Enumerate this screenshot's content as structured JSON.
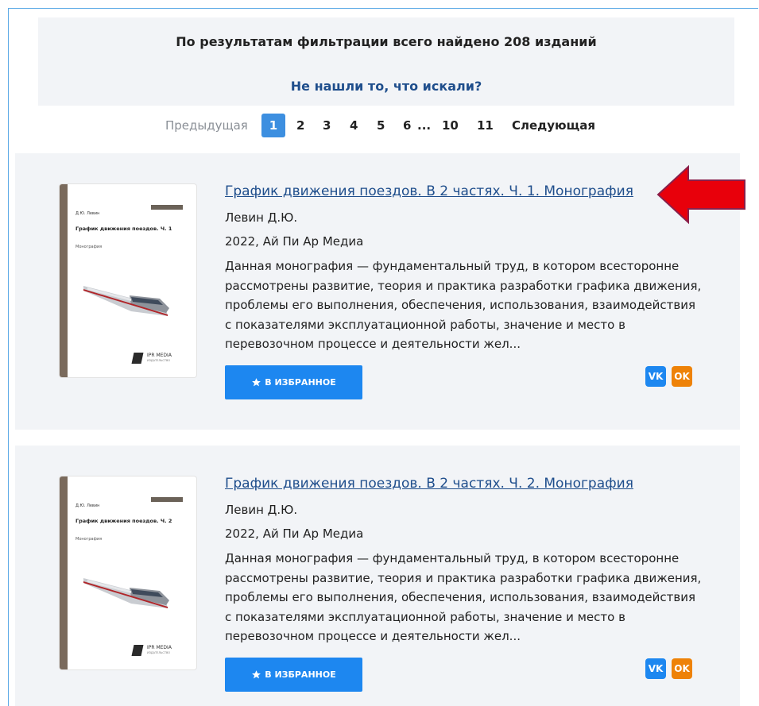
{
  "results": {
    "count_text": "По результатам фильтрации всего найдено 208 изданий",
    "not_found_link": "Не нашли то, что искали?"
  },
  "pagination": {
    "prev_label": "Предыдущая",
    "pages": [
      "1",
      "2",
      "3",
      "4",
      "5",
      "6"
    ],
    "ellipsis": "...",
    "tail_pages": [
      "10",
      "11"
    ],
    "next_label": "Следующая",
    "current": "1"
  },
  "books": [
    {
      "title": "График движения поездов. В 2 частях. Ч. 1. Монография",
      "author": "Левин Д.Ю.",
      "year_publisher": "2022, Ай Пи Ар Медиа",
      "description": "Данная монография — фундаментальный труд, в котором всесторонне рассмотрены развитие, теория и практика разработки графика движения, проблемы его выполнения, обеспечения, использования, взаимодействия с показателями эксплуатационной работы, значение и место в перевозочном процессе и деятельности жел...",
      "fav_label": "В ИЗБРАННОЕ",
      "cover_author": "Д.Ю. Левин",
      "cover_title": "График движения поездов. Ч. 1",
      "cover_genre": "Монография"
    },
    {
      "title": "График движения поездов. В 2 частях. Ч. 2. Монография",
      "author": "Левин Д.Ю.",
      "year_publisher": "2022, Ай Пи Ар Медиа",
      "description": "Данная монография — фундаментальный труд, в котором всесторонне рассмотрены развитие, теория и практика разработки графика движения, проблемы его выполнения, обеспечения, использования, взаимодействия с показателями эксплуатационной работы, значение и место в перевозочном процессе и деятельности жел...",
      "fav_label": "В ИЗБРАННОЕ",
      "cover_author": "Д.Ю. Левин",
      "cover_title": "График движения поездов. Ч. 2",
      "cover_genre": "Монография"
    }
  ],
  "cover_logo": {
    "name": "IPR MEDIA",
    "sub": "ИЗДАТЕЛЬСТВО"
  },
  "share": {
    "vk_label": "VK",
    "ok_label": "OK"
  },
  "icons": {
    "favorite": "star-icon",
    "arrow": "red-arrow-icon"
  },
  "colors": {
    "accent": "#1d87f0",
    "link": "#1f4e8c",
    "ok": "#ee8208",
    "arrow": "#e8000b"
  }
}
